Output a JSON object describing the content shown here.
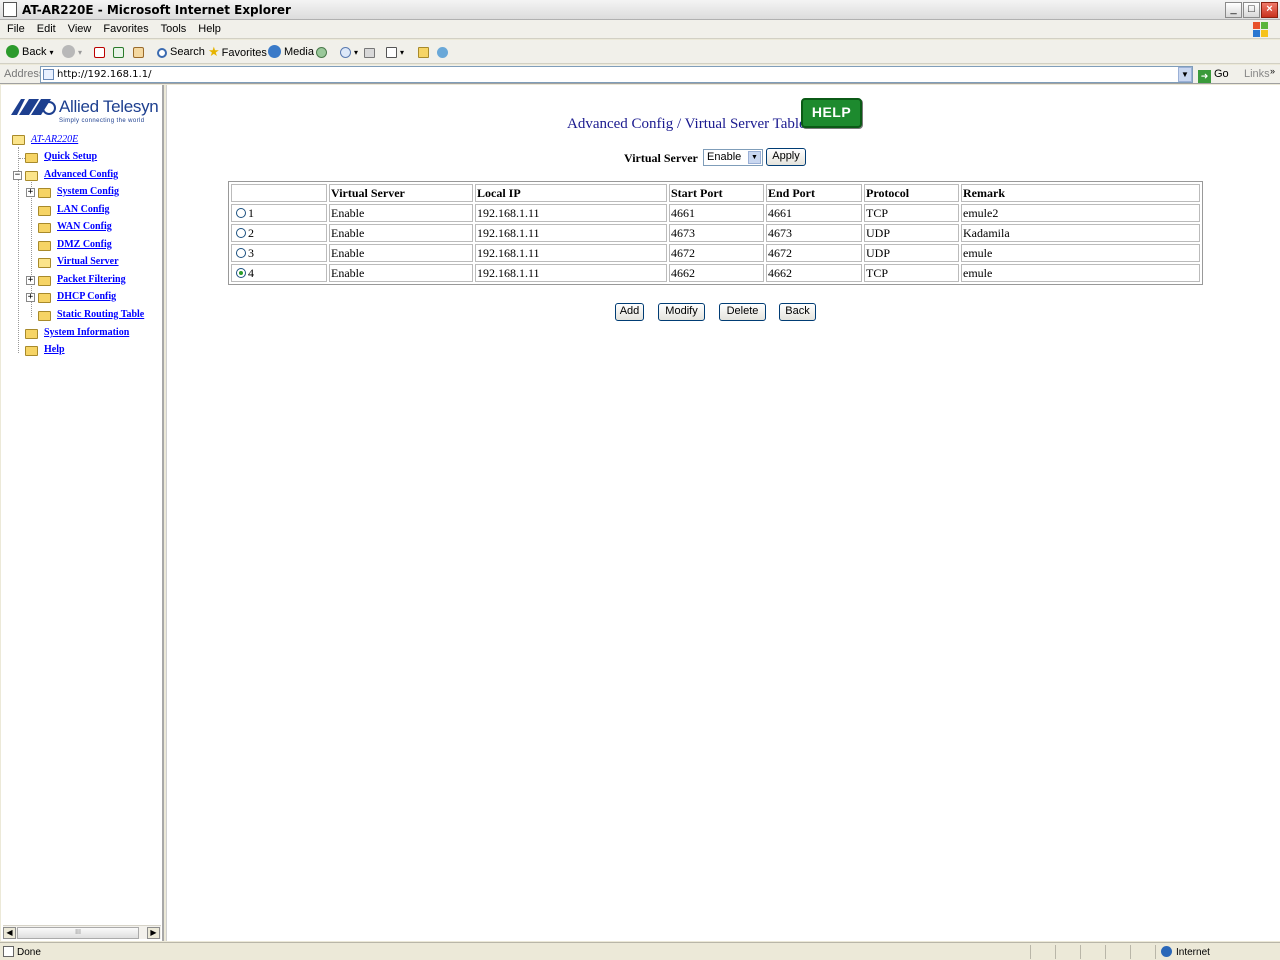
{
  "window": {
    "title": "AT-AR220E - Microsoft Internet Explorer",
    "minimize": "_",
    "maximize": "□",
    "close": "×"
  },
  "menu": [
    "File",
    "Edit",
    "View",
    "Favorites",
    "Tools",
    "Help"
  ],
  "toolbar": {
    "back": "Back",
    "search": "Search",
    "favorites": "Favorites",
    "media": "Media"
  },
  "address": {
    "label": "Address",
    "url": "http://192.168.1.1/",
    "go": "Go",
    "links": "Links"
  },
  "logo": {
    "brand": "Allied Telesyn",
    "tagline": "Simply connecting the world"
  },
  "tree": {
    "root": "AT-AR220E",
    "items": [
      {
        "label": "Quick Setup"
      },
      {
        "label": "Advanced Config"
      },
      {
        "label": "System Config"
      },
      {
        "label": "LAN Config"
      },
      {
        "label": "WAN Config"
      },
      {
        "label": "DMZ Config"
      },
      {
        "label": "Virtual Server"
      },
      {
        "label": "Packet Filtering"
      },
      {
        "label": "DHCP Config"
      },
      {
        "label": "Static Routing Table"
      },
      {
        "label": "System Information"
      },
      {
        "label": "Help"
      }
    ]
  },
  "page": {
    "title": "Advanced Config / Virtual Server Table",
    "help_label": "HELP",
    "vs_label": "Virtual Server",
    "vs_value": "Enable",
    "apply": "Apply"
  },
  "table": {
    "headers": [
      "",
      "Virtual Server",
      "Local IP",
      "Start Port",
      "End Port",
      "Protocol",
      "Remark"
    ],
    "rows": [
      {
        "id": "1",
        "vs": "Enable",
        "ip": "192.168.1.11",
        "start": "4661",
        "end": "4661",
        "proto": "TCP",
        "remark": "emule2",
        "selected": false
      },
      {
        "id": "2",
        "vs": "Enable",
        "ip": "192.168.1.11",
        "start": "4673",
        "end": "4673",
        "proto": "UDP",
        "remark": "Kadamila",
        "selected": false
      },
      {
        "id": "3",
        "vs": "Enable",
        "ip": "192.168.1.11",
        "start": "4672",
        "end": "4672",
        "proto": "UDP",
        "remark": "emule",
        "selected": false
      },
      {
        "id": "4",
        "vs": "Enable",
        "ip": "192.168.1.11",
        "start": "4662",
        "end": "4662",
        "proto": "TCP",
        "remark": "emule",
        "selected": true
      }
    ]
  },
  "actions": {
    "add": "Add",
    "modify": "Modify",
    "delete": "Delete",
    "back": "Back"
  },
  "status": {
    "text": "Done",
    "zone": "Internet"
  },
  "scroll_thumb": "III"
}
